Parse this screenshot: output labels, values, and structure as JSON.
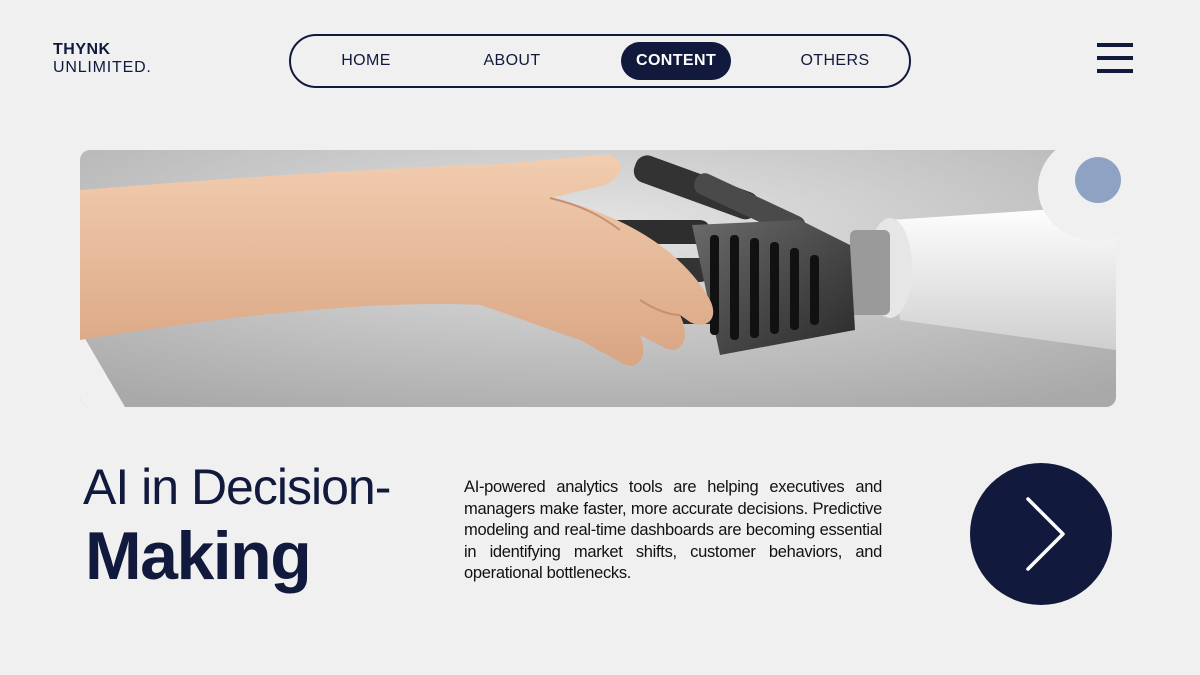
{
  "brand": {
    "line1": "THYNK",
    "line2": "UNLIMITED."
  },
  "nav": {
    "items": [
      {
        "label": "HOME"
      },
      {
        "label": "ABOUT"
      },
      {
        "label": "CONTENT"
      },
      {
        "label": "OTHERS"
      }
    ],
    "active": "CONTENT"
  },
  "menu": {
    "icon": "hamburger-menu-icon"
  },
  "hero": {
    "image": "human-hand-shaking-robot-hand"
  },
  "headline": {
    "line1": "AI in Decision-",
    "line2": "Making"
  },
  "body": "AI-powered analytics tools are helping executives and managers make faster, more accurate decisions. Predictive modeling and real-time dashboards are becoming essential in identifying market shifts, customer behaviors, and operational bottlenecks.",
  "next": {
    "icon": "chevron-right-icon"
  },
  "colors": {
    "navy": "#111a3d",
    "background": "#f0f0f0",
    "accent_dot": "#8ea3c4"
  }
}
